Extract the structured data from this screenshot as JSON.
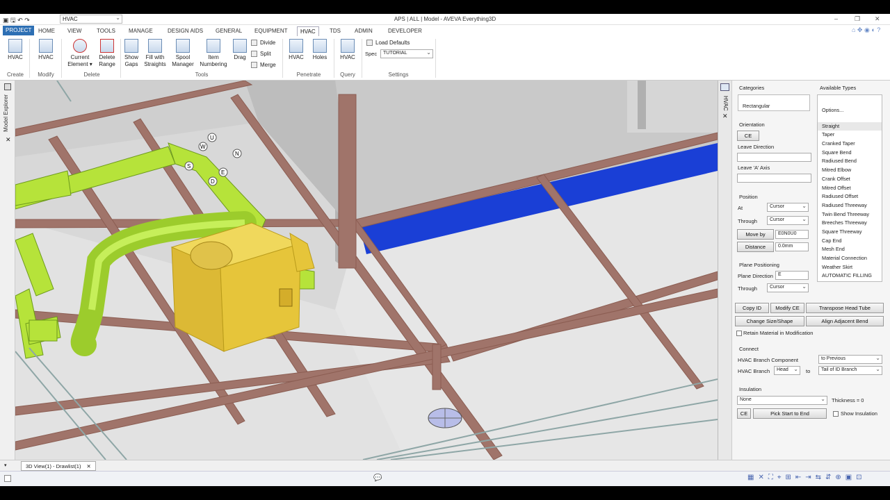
{
  "titlebar": {
    "combo_value": "HVAC",
    "title": "APS | ALL | Model - AVEVA Everything3D"
  },
  "tabs": [
    "PROJECT",
    "HOME",
    "VIEW",
    "TOOLS",
    "MANAGE",
    "DESIGN AIDS",
    "GENERAL",
    "EQUIPMENT",
    "HVAC",
    "TDS",
    "ADMIN",
    "DEVELOPER"
  ],
  "ribbon": {
    "create_hvac": "HVAC",
    "modify_hvac": "HVAC",
    "current_element": "Current\nElement ▾",
    "delete_range": "Delete\nRange",
    "show_gaps": "Show\nGaps",
    "fill_straights": "Fill with\nStraights",
    "spool_manager": "Spool\nManager",
    "item_numbering": "Item\nNumbering",
    "drag": "Drag",
    "divide": "Divide",
    "split": "Split",
    "merge": "Merge",
    "penetrate_hvac": "HVAC",
    "holes": "Holes",
    "query_hvac": "HVAC",
    "load_defaults": "Load Defaults",
    "spec_label": "Spec",
    "spec_value": "TUTORIAL",
    "groups": {
      "create": "Create",
      "modify": "Modify",
      "delete": "Delete",
      "tools": "Tools",
      "penetrate": "Penetrate",
      "query": "Query",
      "settings": "Settings"
    }
  },
  "leftrail": {
    "model_explorer": "Model Explorer"
  },
  "panel": {
    "side_label": "HVAC",
    "categories": "Categories",
    "categories_value": "Rectangular",
    "available_types": "Available Types",
    "options": "Options...",
    "types": [
      "Straight",
      "Taper",
      "Cranked Taper",
      "Square Bend",
      "Radiused Bend",
      "Mitred Elbow",
      "Crank Offset",
      "Mitred Offset",
      "Radiused Offset",
      "Radiused Threeway",
      "Twin Bend Threeway",
      "Breeches Threeway",
      "Square Threeway",
      "Cap End",
      "Mesh End",
      "Material Connection",
      "Weather Skirt",
      "AUTOMATIC FILLING"
    ],
    "orientation": "Orientation",
    "ce": "CE",
    "leave_direction": "Leave Direction",
    "leave_a_axis": "Leave 'A' Axis",
    "position": "Position",
    "at": "At",
    "at_value": "Cursor",
    "through": "Through",
    "through_value": "Cursor",
    "move_by": "Move by",
    "move_by_value": "E0N0U0",
    "distance": "Distance",
    "distance_value": "0.0mm",
    "plane_positioning": "Plane Positioning",
    "plane_direction": "Plane Direction",
    "plane_direction_value": "E",
    "plane_through": "Through",
    "plane_through_value": "Cursor",
    "copy_id": "Copy ID",
    "modify_ce": "Modify CE",
    "transpose": "Transpose Head Tube",
    "change_size": "Change Size/Shape",
    "align_bend": "Align Adjacent Bend",
    "retain_material": "Retain Material in Modification",
    "connect": "Connect",
    "branch_component": "HVAC Branch Component",
    "branch_component_value": "to Previous",
    "hvac_branch": "HVAC Branch",
    "head_value": "Head",
    "to": "to",
    "tail_value": "Tail of ID Branch",
    "insulation": "Insulation",
    "insulation_value": "None",
    "thickness": "Thickness = 0",
    "ins_ce": "CE",
    "pick_start_end": "Pick Start to End",
    "show_insulation": "Show Insulation"
  },
  "viewport": {
    "compass": {
      "u": "U",
      "s": "S",
      "w": "W",
      "e": "E",
      "n": "N",
      "d": "D"
    }
  },
  "doctab": {
    "label": "3D View(1) - Drawlist(1)"
  },
  "colors": {
    "ribbon_accent": "#2d6fb4",
    "duct_green": "#b6e33a",
    "duct_blue": "#1a3fd6",
    "beam": "#a0746a",
    "equipment": "#e6c53a"
  }
}
